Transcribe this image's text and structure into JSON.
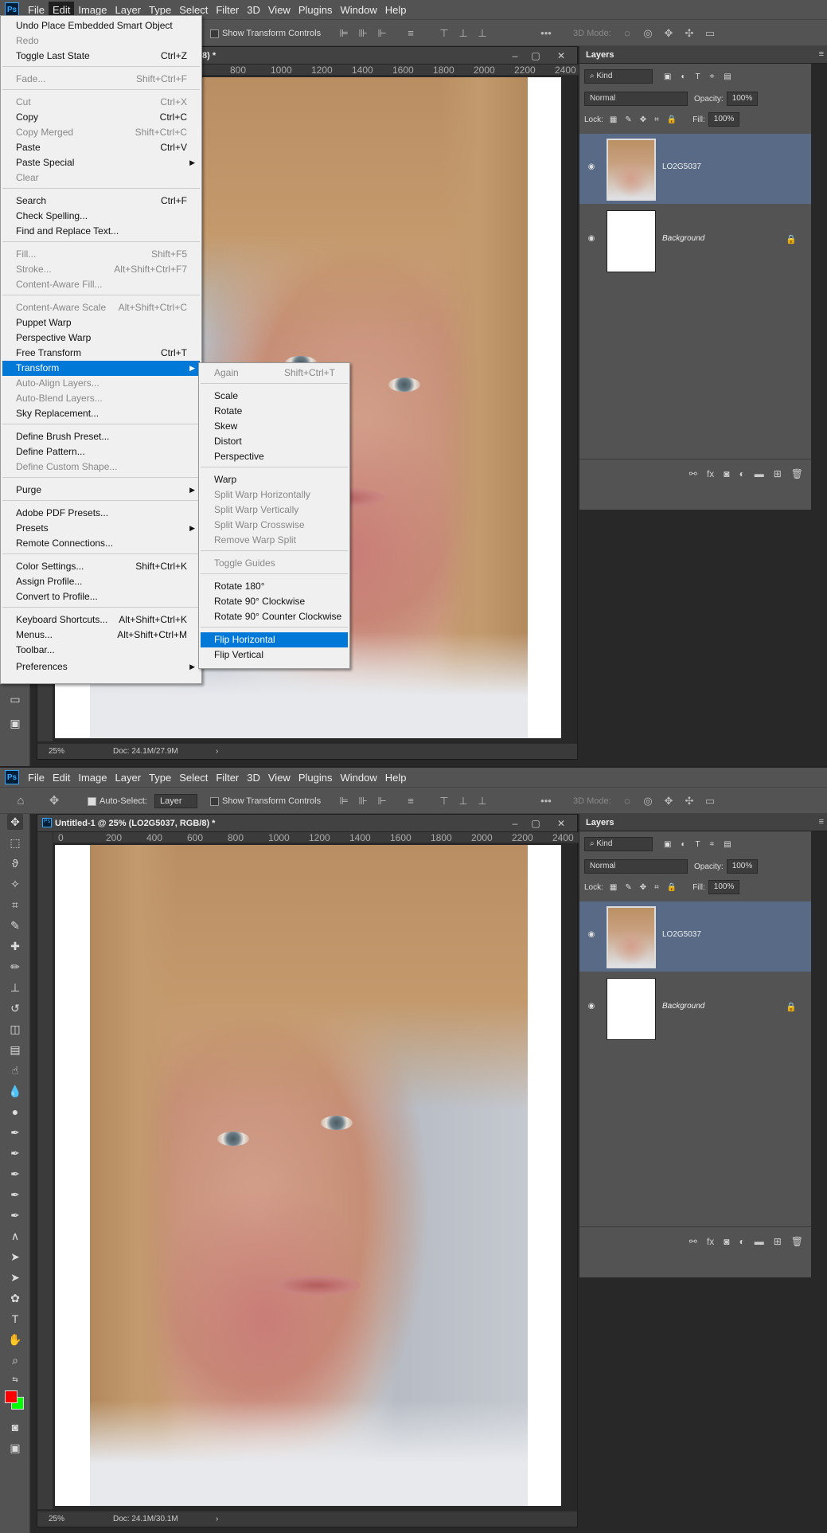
{
  "menubar": {
    "items": [
      "File",
      "Edit",
      "Image",
      "Layer",
      "Type",
      "Select",
      "Filter",
      "3D",
      "View",
      "Plugins",
      "Window",
      "Help"
    ],
    "active": "Edit"
  },
  "options": {
    "auto_select_label": "Auto-Select:",
    "auto_select_target": "Layer",
    "show_transform": "Show Transform Controls",
    "mode3d": "3D Mode:",
    "more": "•••"
  },
  "doc": {
    "title": "Untitled-1 @ 25% (LO2G5037, RGB/8) *",
    "title_partial": "/8) *",
    "zoom": "25%",
    "doc_size_top": "Doc: 24.1M/27.9M",
    "doc_size_bottom": "Doc: 24.1M/30.1M",
    "ruler_top": [
      "800",
      "1000",
      "1200",
      "1400",
      "1600",
      "1800",
      "2000",
      "2200",
      "2400"
    ],
    "ruler_bottom": [
      "0",
      "200",
      "400",
      "600",
      "800",
      "1000",
      "1200",
      "1400",
      "1600",
      "1800",
      "2000",
      "2200",
      "2400"
    ]
  },
  "layers": {
    "tab": "Layers",
    "kind": "Kind",
    "blend": "Normal",
    "opacity_label": "Opacity:",
    "opacity": "100%",
    "lock_label": "Lock:",
    "fill_label": "Fill:",
    "fill": "100%",
    "items": [
      {
        "name": "LO2G5037"
      },
      {
        "name": "Background"
      }
    ]
  },
  "edit_menu": [
    {
      "label": "Undo Place Embedded Smart Object",
      "shortcut": ""
    },
    {
      "label": "Redo",
      "shortcut": "",
      "disabled": true
    },
    {
      "label": "Toggle Last State",
      "shortcut": "Ctrl+Z"
    },
    {
      "label": "Fade...",
      "shortcut": "Shift+Ctrl+F",
      "disabled": true
    },
    {
      "label": "Cut",
      "shortcut": "Ctrl+X",
      "disabled": true
    },
    {
      "label": "Copy",
      "shortcut": "Ctrl+C"
    },
    {
      "label": "Copy Merged",
      "shortcut": "Shift+Ctrl+C",
      "disabled": true
    },
    {
      "label": "Paste",
      "shortcut": "Ctrl+V"
    },
    {
      "label": "Paste Special",
      "shortcut": "",
      "sub": true
    },
    {
      "label": "Clear",
      "shortcut": "",
      "disabled": true
    },
    {
      "label": "Search",
      "shortcut": "Ctrl+F"
    },
    {
      "label": "Check Spelling...",
      "shortcut": ""
    },
    {
      "label": "Find and Replace Text...",
      "shortcut": ""
    },
    {
      "label": "Fill...",
      "shortcut": "Shift+F5",
      "disabled": true
    },
    {
      "label": "Stroke...",
      "shortcut": "Alt+Shift+Ctrl+F7",
      "disabled": true
    },
    {
      "label": "Content-Aware Fill...",
      "shortcut": "",
      "disabled": true
    },
    {
      "label": "Content-Aware Scale",
      "shortcut": "Alt+Shift+Ctrl+C",
      "disabled": true
    },
    {
      "label": "Puppet Warp",
      "shortcut": ""
    },
    {
      "label": "Perspective Warp",
      "shortcut": ""
    },
    {
      "label": "Free Transform",
      "shortcut": "Ctrl+T"
    },
    {
      "label": "Transform",
      "shortcut": "",
      "sub": true,
      "highlighted": true
    },
    {
      "label": "Auto-Align Layers...",
      "shortcut": "",
      "disabled": true
    },
    {
      "label": "Auto-Blend Layers...",
      "shortcut": "",
      "disabled": true
    },
    {
      "label": "Sky Replacement...",
      "shortcut": ""
    },
    {
      "label": "Define Brush Preset...",
      "shortcut": ""
    },
    {
      "label": "Define Pattern...",
      "shortcut": ""
    },
    {
      "label": "Define Custom Shape...",
      "shortcut": "",
      "disabled": true
    },
    {
      "label": "Purge",
      "shortcut": "",
      "sub": true
    },
    {
      "label": "Adobe PDF Presets...",
      "shortcut": ""
    },
    {
      "label": "Presets",
      "shortcut": "",
      "sub": true
    },
    {
      "label": "Remote Connections...",
      "shortcut": ""
    },
    {
      "label": "Color Settings...",
      "shortcut": "Shift+Ctrl+K"
    },
    {
      "label": "Assign Profile...",
      "shortcut": ""
    },
    {
      "label": "Convert to Profile...",
      "shortcut": ""
    },
    {
      "label": "Keyboard Shortcuts...",
      "shortcut": "Alt+Shift+Ctrl+K"
    },
    {
      "label": "Menus...",
      "shortcut": "Alt+Shift+Ctrl+M"
    },
    {
      "label": "Toolbar...",
      "shortcut": ""
    },
    {
      "label": "Preferences",
      "shortcut": "",
      "sub": true
    }
  ],
  "transform_menu": [
    {
      "label": "Again",
      "shortcut": "Shift+Ctrl+T",
      "disabled": true
    },
    {
      "label": "Scale",
      "shortcut": ""
    },
    {
      "label": "Rotate",
      "shortcut": ""
    },
    {
      "label": "Skew",
      "shortcut": ""
    },
    {
      "label": "Distort",
      "shortcut": ""
    },
    {
      "label": "Perspective",
      "shortcut": ""
    },
    {
      "label": "Warp",
      "shortcut": ""
    },
    {
      "label": "Split Warp Horizontally",
      "shortcut": "",
      "disabled": true
    },
    {
      "label": "Split Warp Vertically",
      "shortcut": "",
      "disabled": true
    },
    {
      "label": "Split Warp Crosswise",
      "shortcut": "",
      "disabled": true
    },
    {
      "label": "Remove Warp Split",
      "shortcut": "",
      "disabled": true
    },
    {
      "label": "Toggle Guides",
      "shortcut": "",
      "disabled": true
    },
    {
      "label": "Rotate 180°",
      "shortcut": ""
    },
    {
      "label": "Rotate 90° Clockwise",
      "shortcut": ""
    },
    {
      "label": "Rotate 90° Counter Clockwise",
      "shortcut": ""
    },
    {
      "label": "Flip Horizontal",
      "shortcut": "",
      "highlighted": true
    },
    {
      "label": "Flip Vertical",
      "shortcut": ""
    }
  ],
  "colors": {
    "foreground": "#ff0000",
    "background": "#00ff00",
    "accent": "#0078d7",
    "layer_selected": "#586a86"
  }
}
